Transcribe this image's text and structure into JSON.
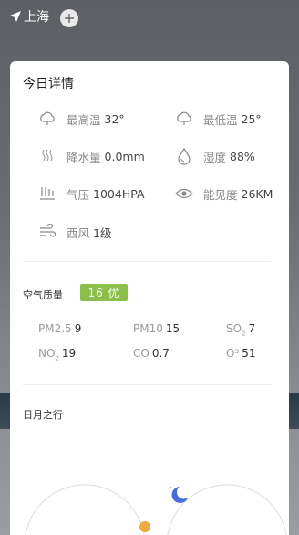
{
  "header": {
    "city": "上海",
    "location_icon": "location-arrow-icon",
    "add_icon": "add-city-icon"
  },
  "card": {
    "title": "今日详情",
    "details": [
      {
        "icon": "cloud-icon",
        "label": "最高温",
        "value": "32°"
      },
      {
        "icon": "cloud-icon",
        "label": "最低温",
        "value": "25°"
      },
      {
        "icon": "rain-icon",
        "label": "降水量",
        "value": "0.0mm"
      },
      {
        "icon": "humidity-drop-icon",
        "label": "湿度",
        "value": "88%"
      },
      {
        "icon": "pressure-icon",
        "label": "气压",
        "value": "1004HPA"
      },
      {
        "icon": "eye-icon",
        "label": "能见度",
        "value": "26KM"
      },
      {
        "icon": "wind-icon",
        "label": "西风",
        "value": "1级"
      }
    ],
    "air_quality": {
      "title": "空气质量",
      "badge": "16 优",
      "badge_color": "#8bbf4a",
      "pollutants": [
        {
          "name": "PM2.5",
          "value": "9"
        },
        {
          "name": "PM10",
          "value": "15"
        },
        {
          "name": "SO",
          "sub": "2",
          "value": "7"
        },
        {
          "name": "NO",
          "sub": "2",
          "value": "19"
        },
        {
          "name": "CO",
          "value": "0.7"
        },
        {
          "name": "O³",
          "value": "51"
        }
      ]
    },
    "sun_moon": {
      "title": "日月之行"
    }
  }
}
